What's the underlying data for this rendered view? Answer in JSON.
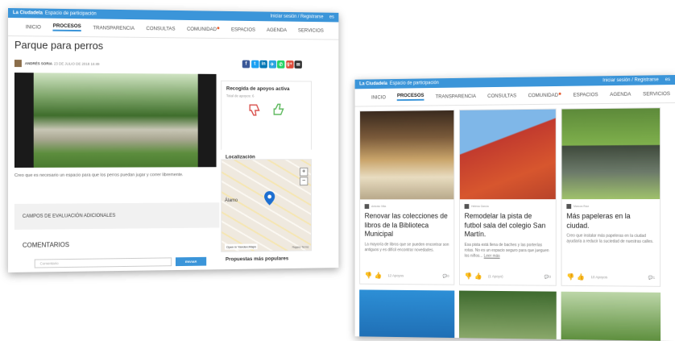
{
  "site": {
    "brand": "La Ciudadela",
    "tagline": "Espacio de participación",
    "login": "Iniciar sesión / Registrarse",
    "lang": "es"
  },
  "nav": [
    "INICIO",
    "PROCESOS",
    "TRANSPARENCIA",
    "CONSULTAS",
    "COMUNIDAD",
    "ESPACIOS",
    "AGENDA",
    "SERVICIOS"
  ],
  "proposal": {
    "title": "Parque para perros",
    "author": "ANDRÉS SORIA",
    "date": "23 DE JULIO DE 2018 16:49",
    "description": "Creo que es necesario un espacio para que los perros puedan jugar y correr libremente.",
    "campos": "CAMPOS DE EVALUACIÓN ADICIONALES",
    "comments_title": "COMENTARIOS",
    "comment_placeholder": "Comentario",
    "comment_button": "ENVIAR",
    "support_title": "Recogida de apoyos activa",
    "support_total": "Total de apoyos: 6",
    "location_title": "Localización",
    "map_label": "Álamo",
    "map_open": "Open in Yandex.Maps",
    "map_credit": "Яндекс Terms",
    "popular_title": "Propuestas más populares",
    "share": [
      {
        "icon": "facebook-icon",
        "glyph": "f",
        "color": "#3b5998"
      },
      {
        "icon": "twitter-icon",
        "glyph": "t",
        "color": "#1da1f2"
      },
      {
        "icon": "linkedin-icon",
        "glyph": "in",
        "color": "#0077b5"
      },
      {
        "icon": "telegram-icon",
        "glyph": "✈",
        "color": "#2ca5e0"
      },
      {
        "icon": "whatsapp-icon",
        "glyph": "✆",
        "color": "#25d366"
      },
      {
        "icon": "google-plus-icon",
        "glyph": "g+",
        "color": "#dd4b39"
      },
      {
        "icon": "email-icon",
        "glyph": "✉",
        "color": "#333333"
      }
    ]
  },
  "cards": [
    {
      "author": "Antonio Villa",
      "date": "23 de julio de 2018 16:52",
      "title": "Renovar las colecciones de libros de la Biblioteca Municipal",
      "desc": "La mayoría de libros que se pueden encontrar son antiguos y es difícil encontrar novedades.",
      "supports": "12 Apoyos",
      "comments": "0"
    },
    {
      "author": "Helena García",
      "date": "23 de julio de 2018 16:57",
      "title": "Remodelar la pista de futbol sala del colegio San Martín.",
      "desc": "Esa pista está llena de baches y las porterías rotas. No es un espacio seguro para que jueguen los niños...",
      "more": "Leer más",
      "supports": "(1 Apoyo)",
      "comments": "0"
    },
    {
      "author": "Marcos Ruiz",
      "date": "23 de julio de 2018 16:59",
      "title": "Más papeleras en la ciudad.",
      "desc": "Creo que instalar más papeleras en la ciudad ayudaría a reducir la suciedad de nuestras calles.",
      "supports": "10 Apoyos",
      "comments": "1"
    }
  ],
  "colors": {
    "accent": "#3b95d9",
    "dislike": "#d9534f",
    "like": "#5cb85c"
  }
}
